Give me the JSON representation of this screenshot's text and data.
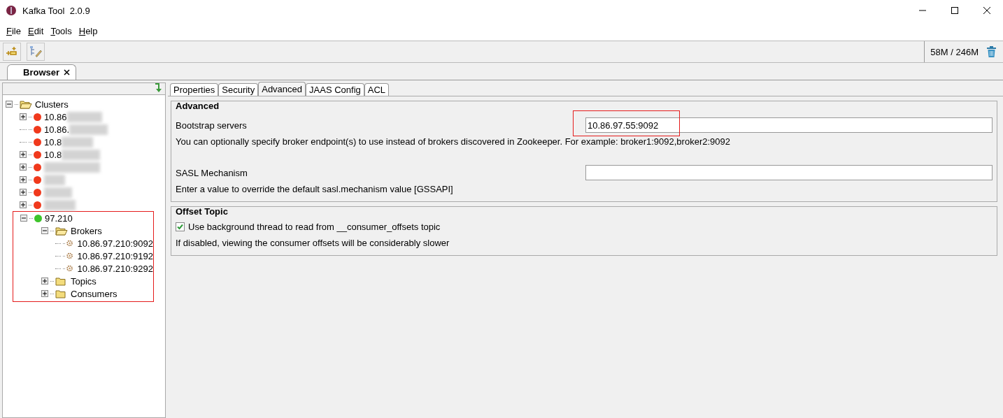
{
  "window": {
    "title": "Kafka Tool  2.0.9"
  },
  "menu": [
    {
      "label": "File",
      "underlined": true
    },
    {
      "label": "Edit",
      "underlined": true
    },
    {
      "label": "Tools",
      "underlined": true
    },
    {
      "label": "Help",
      "underlined": true
    }
  ],
  "toolbar": {
    "memory": "58M / 246M"
  },
  "view_tab": {
    "label": "Browser",
    "selected": true
  },
  "tree": [
    {
      "label": "Clusters",
      "kind": "folder",
      "expanded": true,
      "children": [
        {
          "label": "10.86",
          "kind": "cluster",
          "color": "#f0391c",
          "expanded": false,
          "blurred": true
        },
        {
          "label": "10.86.",
          "kind": "cluster",
          "color": "#f0391c",
          "blurred": true
        },
        {
          "label": "10.8",
          "kind": "cluster",
          "color": "#f0391c",
          "blurred": true
        },
        {
          "label": "10.8",
          "kind": "cluster",
          "color": "#f0391c",
          "expanded": false,
          "blurred": true
        },
        {
          "kind": "cluster",
          "color": "#f0391c",
          "expanded": false,
          "blurred": true
        },
        {
          "kind": "cluster",
          "color": "#f0391c",
          "expanded": false,
          "blurred": true
        },
        {
          "kind": "cluster",
          "color": "#f0391c",
          "expanded": false,
          "blurred": true
        },
        {
          "kind": "cluster",
          "color": "#f0391c",
          "expanded": false,
          "blurred": true
        },
        {
          "label": "97.210",
          "kind": "cluster",
          "color": "#3ec42b",
          "expanded": true,
          "highlighted": true,
          "children": [
            {
              "label": "Brokers",
              "kind": "folder",
              "expanded": true,
              "children": [
                {
                  "label": "10.86.97.210:9092",
                  "kind": "broker"
                },
                {
                  "label": "10.86.97.210:9192",
                  "kind": "broker"
                },
                {
                  "label": "10.86.97.210:9292",
                  "kind": "broker"
                }
              ]
            },
            {
              "label": "Topics",
              "kind": "folder",
              "expanded": false
            },
            {
              "label": "Consumers",
              "kind": "folder",
              "expanded": false
            }
          ]
        }
      ]
    }
  ],
  "tabs": [
    {
      "label": "Properties",
      "selected": false
    },
    {
      "label": "Security",
      "selected": false
    },
    {
      "label": "Advanced",
      "selected": true
    },
    {
      "label": "JAAS Config",
      "selected": false
    },
    {
      "label": "ACL",
      "selected": false
    }
  ],
  "advanced": {
    "title": "Advanced",
    "fields": [
      {
        "label": "Bootstrap servers",
        "value": "10.86.97.55:9092",
        "hint": "You can optionally specify broker endpoint(s) to use instead of brokers discovered in Zookeeper. For example: broker1:9092,broker2:9092",
        "highlighted": true
      },
      {
        "label": "SASL Mechanism",
        "hint": "Enter a value to override the default sasl.mechanism value [GSSAPI]"
      }
    ]
  },
  "offset_topic": {
    "title": "Offset Topic",
    "checkbox": {
      "label": "Use background thread to read from __consumer_offsets topic",
      "checked": true
    },
    "note": "If disabled, viewing the consumer offsets will be considerably slower"
  }
}
